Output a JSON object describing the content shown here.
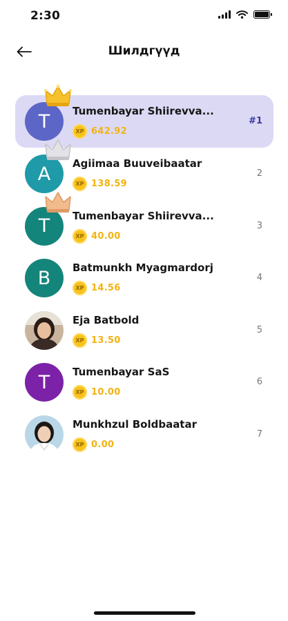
{
  "status_bar": {
    "time": "2:30"
  },
  "header": {
    "title": "Шилдгүүд",
    "back_icon": "arrow-left-icon"
  },
  "leaderboard": [
    {
      "initial": "T",
      "name": "Tumenbayar Shiirevva...",
      "xp_badge": "XP",
      "xp": "642.92",
      "rank": "#1",
      "avatar_color": "#5b66c6",
      "highlighted": true,
      "crown": "gold-crown-icon"
    },
    {
      "initial": "A",
      "name": "Agiimaa Buuveibaatar",
      "xp_badge": "XP",
      "xp": "138.59",
      "rank": "2",
      "avatar_color": "#1f9aa8",
      "crown": "silver-crown-icon"
    },
    {
      "initial": "T",
      "name": "Tumenbayar Shiirevva...",
      "xp_badge": "XP",
      "xp": "40.00",
      "rank": "3",
      "avatar_color": "#14857a",
      "crown": "bronze-crown-icon"
    },
    {
      "initial": "B",
      "name": "Batmunkh Myagmardorj",
      "xp_badge": "XP",
      "xp": "14.56",
      "rank": "4",
      "avatar_color": "#14857a"
    },
    {
      "initial": "",
      "name": "Eja Batbold",
      "xp_badge": "XP",
      "xp": "13.50",
      "rank": "5",
      "avatar": "profile-photo"
    },
    {
      "initial": "T",
      "name": "Tumenbayar SaS",
      "xp_badge": "XP",
      "xp": "10.00",
      "rank": "6",
      "avatar_color": "#7b22a8"
    },
    {
      "initial": "",
      "name": "Munkhzul Boldbaatar",
      "xp_badge": "XP",
      "xp": "0.00",
      "rank": "7",
      "avatar": "profile-photo"
    }
  ],
  "colors": {
    "highlight": "#dcd9f5",
    "xp_text": "#f1b312",
    "coin": "#f7c21c",
    "rank_top": "#3b3aa1"
  }
}
